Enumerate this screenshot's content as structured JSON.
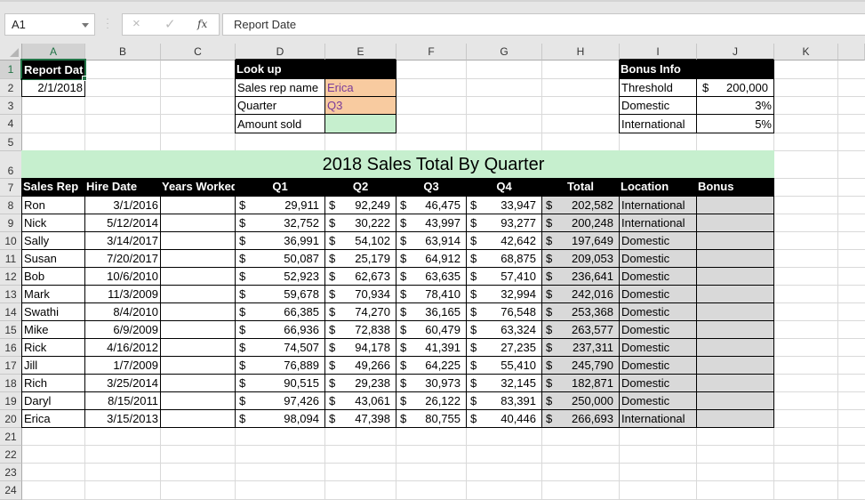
{
  "formula_bar": {
    "name_box": "A1",
    "cancel_icon": "×",
    "enter_icon": "✓",
    "fx_icon": "fx",
    "formula_value": "Report Date"
  },
  "columns": [
    "A",
    "B",
    "C",
    "D",
    "E",
    "F",
    "G",
    "H",
    "I",
    "J",
    "K"
  ],
  "rows": [
    "1",
    "2",
    "3",
    "4",
    "5",
    "6",
    "7",
    "8",
    "9",
    "10",
    "11",
    "12",
    "13",
    "14",
    "15",
    "16",
    "17",
    "18",
    "19",
    "20",
    "21",
    "22",
    "23",
    "24"
  ],
  "report": {
    "label": "Report Dat",
    "date": "2/1/2018"
  },
  "lookup": {
    "title": "Look up",
    "rows": [
      {
        "label": "Sales rep name",
        "value": "Erica"
      },
      {
        "label": "Quarter",
        "value": "Q3"
      },
      {
        "label": "Amount sold",
        "value": ""
      }
    ]
  },
  "bonus_info": {
    "title": "Bonus Info",
    "threshold_label": "Threshold",
    "threshold_currency": "$",
    "threshold_value": "200,000",
    "domestic_label": "Domestic",
    "domestic_value": "3%",
    "international_label": "International",
    "international_value": "5%"
  },
  "sales_table": {
    "title": "2018 Sales Total By Quarter",
    "headers": [
      "Sales Rep",
      "Hire Date",
      "Years Worked",
      "Q1",
      "Q2",
      "Q3",
      "Q4",
      "Total",
      "Location",
      "Bonus"
    ],
    "currency": "$",
    "rows": [
      {
        "rep": "Ron",
        "hire": "3/1/2016",
        "years": "",
        "q1": "29,911",
        "q2": "92,249",
        "q3": "46,475",
        "q4": "33,947",
        "total": "202,582",
        "location": "International",
        "bonus": ""
      },
      {
        "rep": "Nick",
        "hire": "5/12/2014",
        "years": "",
        "q1": "32,752",
        "q2": "30,222",
        "q3": "43,997",
        "q4": "93,277",
        "total": "200,248",
        "location": "International",
        "bonus": ""
      },
      {
        "rep": "Sally",
        "hire": "3/14/2017",
        "years": "",
        "q1": "36,991",
        "q2": "54,102",
        "q3": "63,914",
        "q4": "42,642",
        "total": "197,649",
        "location": "Domestic",
        "bonus": ""
      },
      {
        "rep": "Susan",
        "hire": "7/20/2017",
        "years": "",
        "q1": "50,087",
        "q2": "25,179",
        "q3": "64,912",
        "q4": "68,875",
        "total": "209,053",
        "location": "Domestic",
        "bonus": ""
      },
      {
        "rep": "Bob",
        "hire": "10/6/2010",
        "years": "",
        "q1": "52,923",
        "q2": "62,673",
        "q3": "63,635",
        "q4": "57,410",
        "total": "236,641",
        "location": "Domestic",
        "bonus": ""
      },
      {
        "rep": "Mark",
        "hire": "11/3/2009",
        "years": "",
        "q1": "59,678",
        "q2": "70,934",
        "q3": "78,410",
        "q4": "32,994",
        "total": "242,016",
        "location": "Domestic",
        "bonus": ""
      },
      {
        "rep": "Swathi",
        "hire": "8/4/2010",
        "years": "",
        "q1": "66,385",
        "q2": "74,270",
        "q3": "36,165",
        "q4": "76,548",
        "total": "253,368",
        "location": "Domestic",
        "bonus": ""
      },
      {
        "rep": "Mike",
        "hire": "6/9/2009",
        "years": "",
        "q1": "66,936",
        "q2": "72,838",
        "q3": "60,479",
        "q4": "63,324",
        "total": "263,577",
        "location": "Domestic",
        "bonus": ""
      },
      {
        "rep": "Rick",
        "hire": "4/16/2012",
        "years": "",
        "q1": "74,507",
        "q2": "94,178",
        "q3": "41,391",
        "q4": "27,235",
        "total": "237,311",
        "location": "Domestic",
        "bonus": ""
      },
      {
        "rep": "Jill",
        "hire": "1/7/2009",
        "years": "",
        "q1": "76,889",
        "q2": "49,266",
        "q3": "64,225",
        "q4": "55,410",
        "total": "245,790",
        "location": "Domestic",
        "bonus": ""
      },
      {
        "rep": "Rich",
        "hire": "3/25/2014",
        "years": "",
        "q1": "90,515",
        "q2": "29,238",
        "q3": "30,973",
        "q4": "32,145",
        "total": "182,871",
        "location": "Domestic",
        "bonus": ""
      },
      {
        "rep": "Daryl",
        "hire": "8/15/2011",
        "years": "",
        "q1": "97,426",
        "q2": "43,061",
        "q3": "26,122",
        "q4": "83,391",
        "total": "250,000",
        "location": "Domestic",
        "bonus": ""
      },
      {
        "rep": "Erica",
        "hire": "3/15/2013",
        "years": "",
        "q1": "98,094",
        "q2": "47,398",
        "q3": "80,755",
        "q4": "40,446",
        "total": "266,693",
        "location": "International",
        "bonus": ""
      }
    ]
  }
}
